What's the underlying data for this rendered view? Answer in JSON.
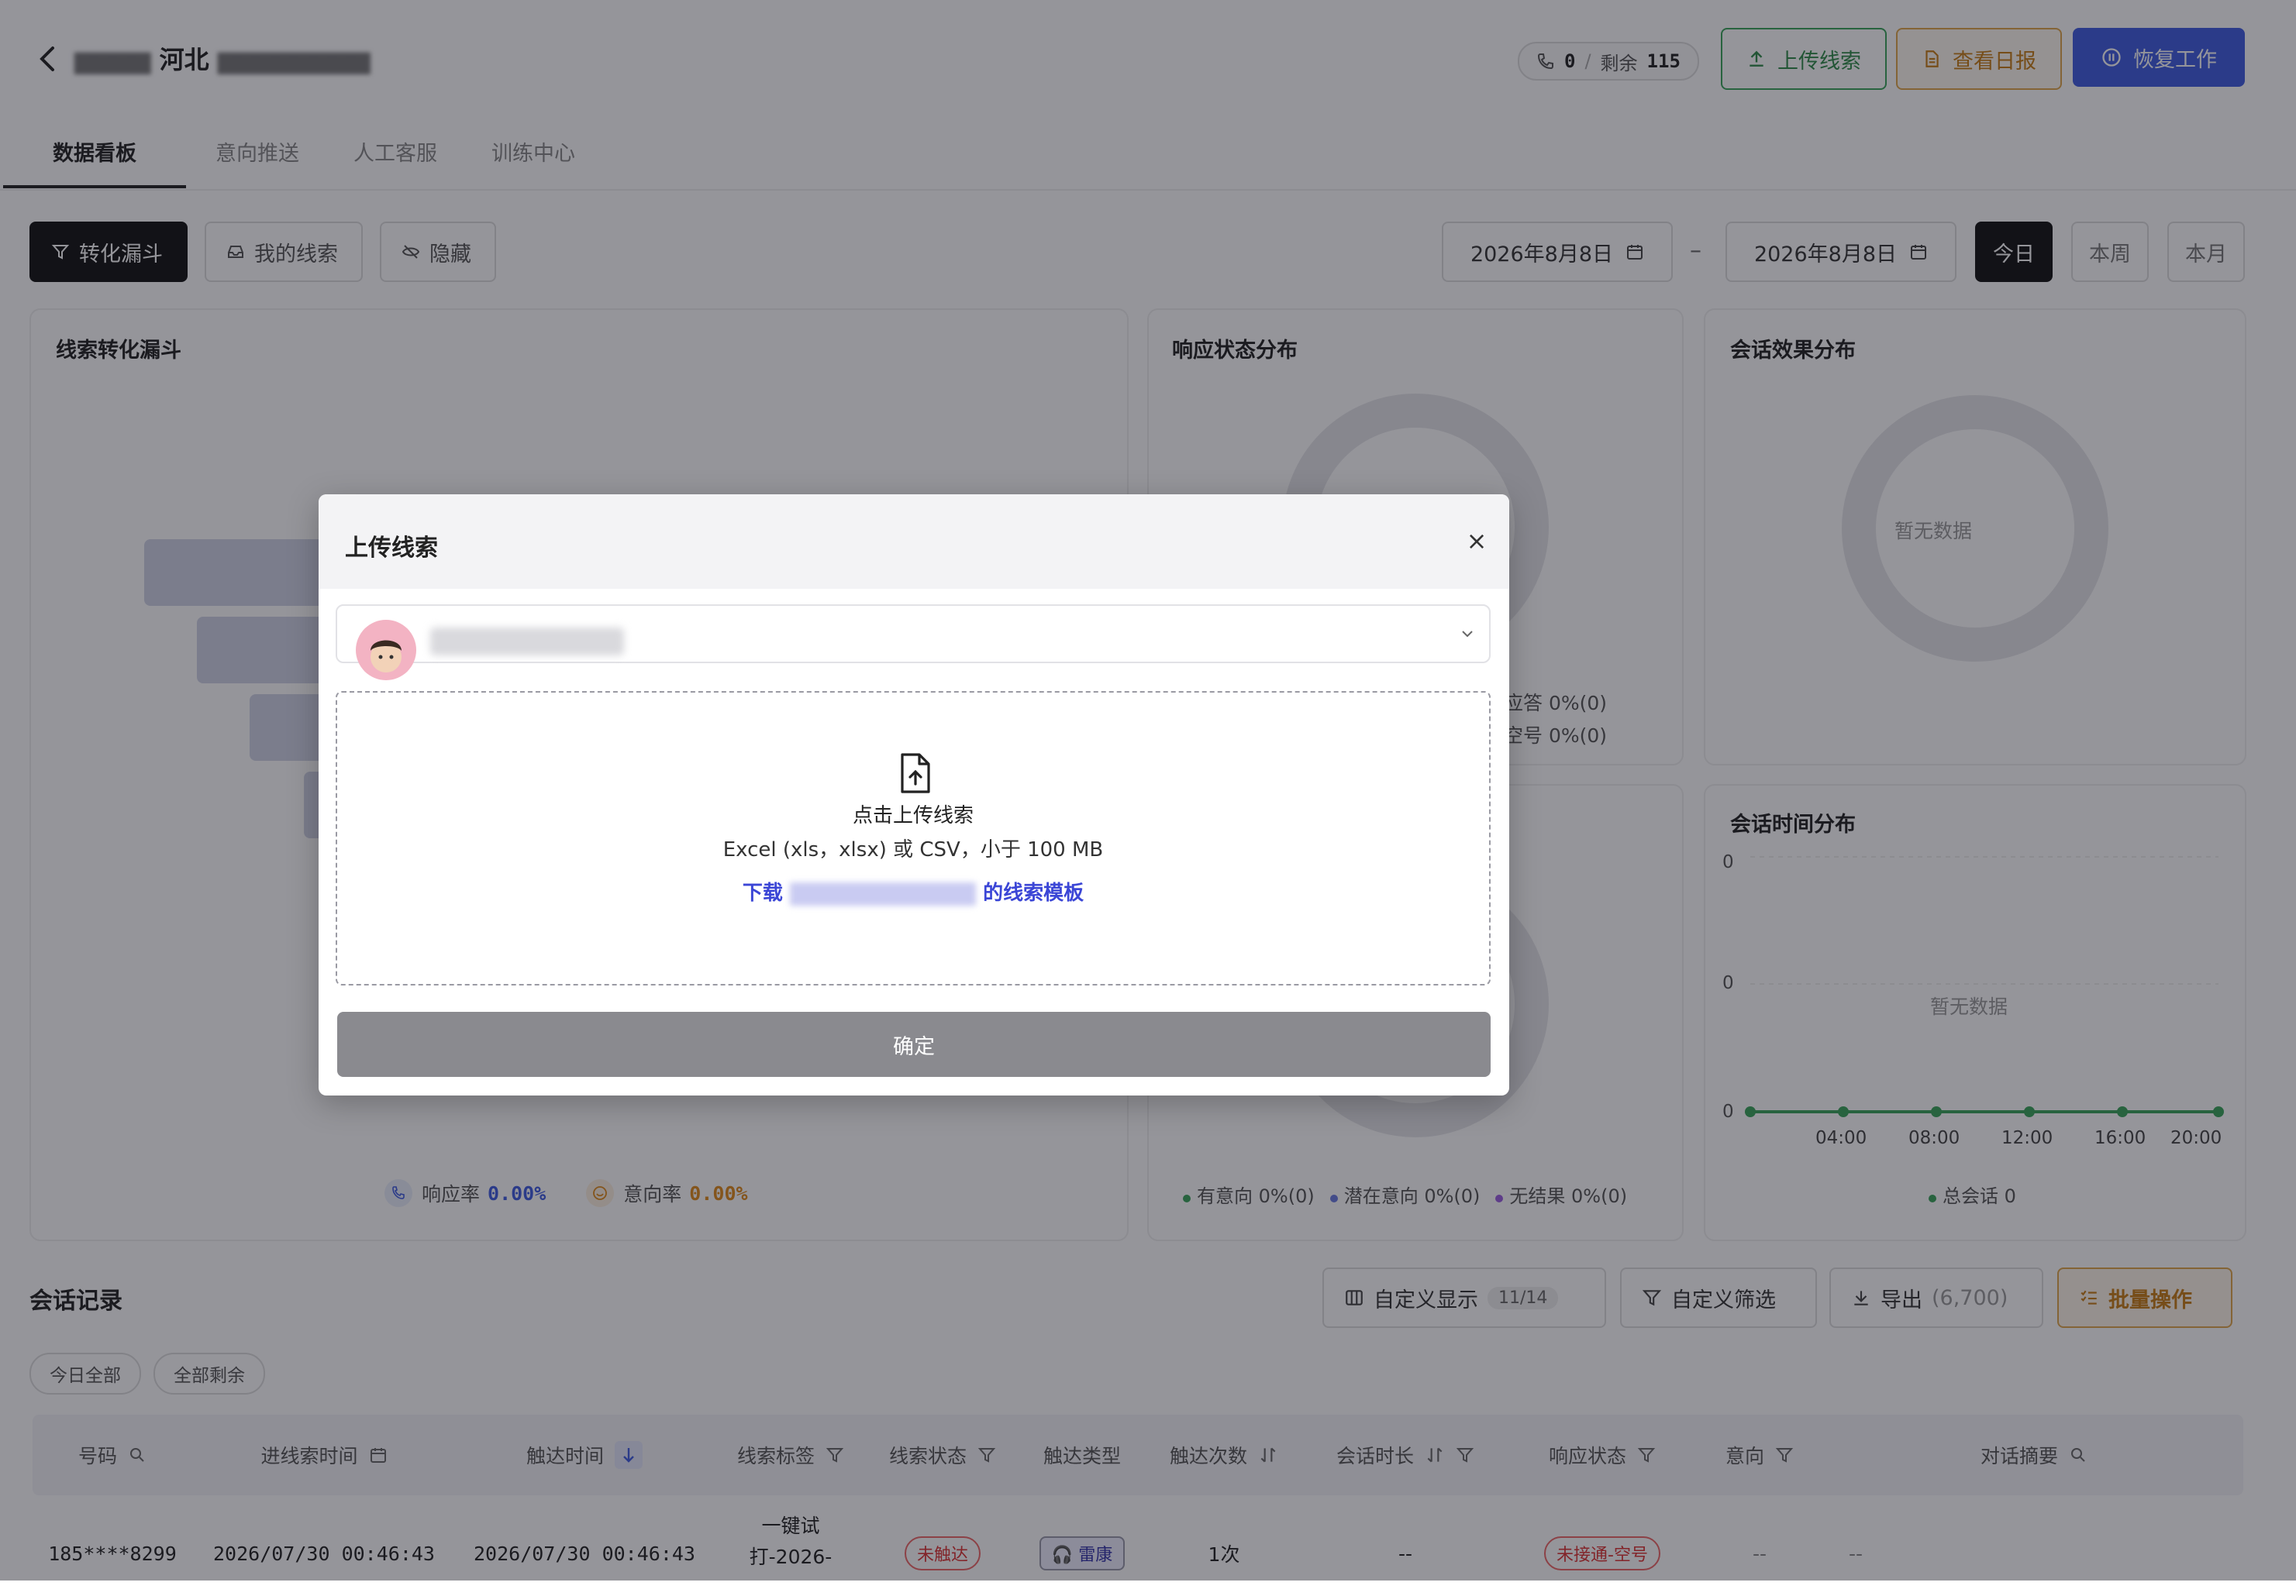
{
  "header": {
    "title_visible": "河北",
    "call_count": "0",
    "separator": "/",
    "remaining_label": "剩余",
    "remaining_value": "115",
    "upload_label": "上传线索",
    "report_label": "查看日报",
    "resume_label": "恢复工作"
  },
  "tabs": [
    "数据看板",
    "意向推送",
    "人工客服",
    "训练中心"
  ],
  "filters": {
    "funnel_label": "转化漏斗",
    "my_leads_label": "我的线索",
    "hide_label": "隐藏",
    "date_start": "2026年8月8日",
    "date_sep": "–",
    "date_end": "2026年8月8日",
    "ranges": [
      "今日",
      "本周",
      "本月"
    ]
  },
  "funnel_card": {
    "title": "线索转化漏斗",
    "response_label": "响应率",
    "response_value": "0.00%",
    "intent_label": "意向率",
    "intent_value": "0.00%"
  },
  "response_card": {
    "title": "响应状态分布",
    "legend_1": "应答 0%(0)",
    "legend_2": "空号 0%(0)"
  },
  "session_effect_card": {
    "title": "会话效果分布",
    "no_data": "暂无数据"
  },
  "intent_card": {
    "legend": [
      "有意向 0%(0)",
      "潜在意向 0%(0)",
      "无结果 0%(0)"
    ]
  },
  "session_time_card": {
    "title": "会话时间分布",
    "no_data": "暂无数据",
    "legend": "总会话 0",
    "y_ticks": [
      "0",
      "0",
      "0"
    ],
    "x_ticks": [
      "04:00",
      "08:00",
      "12:00",
      "16:00",
      "20:00"
    ]
  },
  "records": {
    "title": "会话记录",
    "custom_display_label": "自定义显示",
    "custom_display_count": "11/14",
    "custom_filter_label": "自定义筛选",
    "export_label": "导出",
    "export_count": "(6,700)",
    "batch_label": "批量操作",
    "chip_today": "今日全部",
    "chip_all": "全部剩余",
    "columns": [
      "号码",
      "进线索时间",
      "触达时间",
      "线索标签",
      "线索状态",
      "触达类型",
      "触达次数",
      "会话时长",
      "响应状态",
      "意向",
      "对话摘要"
    ],
    "row": {
      "phone": "185****8299",
      "in_time": "2026/07/30 00:46:43",
      "reach_time": "2026/07/30 00:46:43",
      "tag_line1": "一键试",
      "tag_line2": "打-2026-",
      "status": "未触达",
      "reach_type": "雷康",
      "reach_count": "1次",
      "duration": "--",
      "response": "未接通-空号",
      "intent": "--",
      "summary": "--"
    }
  },
  "modal": {
    "title": "上传线索",
    "close": "×",
    "upload_title": "点击上传线索",
    "upload_hint": "Excel (xls，xlsx) 或 CSV，小于 100 MB",
    "download_prefix": "下载",
    "download_suffix": "的线索模板",
    "confirm_label": "确定"
  },
  "colors": {
    "accent_blue": "#3f5be0",
    "green": "#2e8a48",
    "orange": "#c77d15",
    "link": "#3b46d6"
  }
}
